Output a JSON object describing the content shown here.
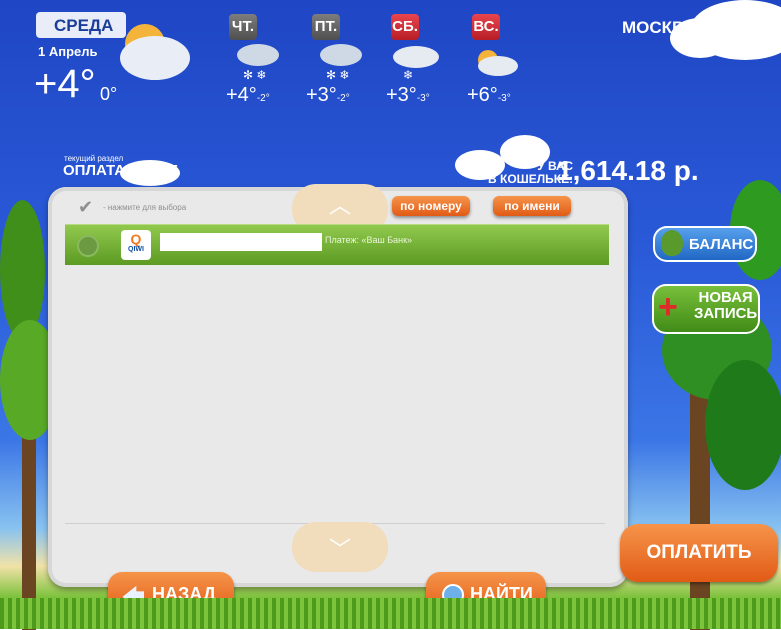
{
  "weather": {
    "today": {
      "day": "СРЕДА",
      "date": "1 Апрель",
      "temp": "+4°",
      "temp_min": "0°"
    },
    "forecast": [
      {
        "day": "ЧТ.",
        "temp": "+4°",
        "min": "-2°",
        "color": "#6a6a6a"
      },
      {
        "day": "ПТ.",
        "temp": "+3°",
        "min": "-2°",
        "color": "#6a6a6a"
      },
      {
        "day": "СБ.",
        "temp": "+3°",
        "min": "-3°",
        "color": "#d0282f"
      },
      {
        "day": "ВС.",
        "temp": "+6°",
        "min": "-3°",
        "color": "#d0282f"
      }
    ],
    "city": "МОСКВА"
  },
  "section": {
    "caption": "текущий раздел",
    "title": "ОПЛАТА УСЛУГ"
  },
  "wallet": {
    "label_line1": "У ВАС",
    "label_line2": "В КОШЕЛЬКЕ:",
    "amount": "1,614.18 р."
  },
  "list": {
    "hint": "- нажмите для выбора",
    "sort_by_number": "по номеру",
    "sort_by_name": "по имени",
    "items": [
      {
        "logo": "QIWI",
        "name": "",
        "payee": "Платеж: «Ваш Банк»"
      }
    ]
  },
  "side": {
    "balance": "БАЛАНС",
    "new_record_line1": "НОВАЯ",
    "new_record_line2": "ЗАПИСЬ"
  },
  "bottom": {
    "back": "НАЗАД",
    "find": "НАЙТИ",
    "pay": "ОПЛАТИТЬ"
  },
  "colors": {
    "accent_orange": "#e8651c",
    "row_green": "#7cb83a",
    "balance_blue": "#2f7bd4",
    "new_green": "#5aa123"
  }
}
